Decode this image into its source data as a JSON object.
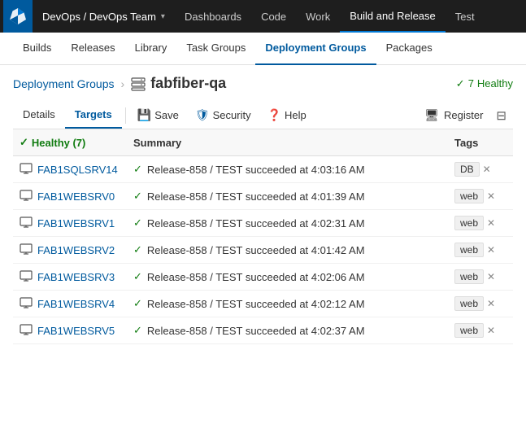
{
  "topNav": {
    "logo_alt": "Azure DevOps",
    "items": [
      {
        "id": "org",
        "label": "DevOps / DevOps Team",
        "hasChevron": true
      },
      {
        "id": "dashboards",
        "label": "Dashboards"
      },
      {
        "id": "code",
        "label": "Code"
      },
      {
        "id": "work",
        "label": "Work"
      },
      {
        "id": "buildrelease",
        "label": "Build and Release",
        "active": true
      },
      {
        "id": "test",
        "label": "Test"
      }
    ]
  },
  "secondNav": {
    "items": [
      {
        "id": "builds",
        "label": "Builds"
      },
      {
        "id": "releases",
        "label": "Releases"
      },
      {
        "id": "library",
        "label": "Library"
      },
      {
        "id": "taskgroups",
        "label": "Task Groups"
      },
      {
        "id": "deploymentgroups",
        "label": "Deployment Groups",
        "active": true
      },
      {
        "id": "packages",
        "label": "Packages"
      }
    ]
  },
  "breadcrumb": {
    "parent": "Deployment Groups",
    "separator": "›",
    "current": "fabfiber-qa",
    "healthyCount": "7",
    "healthyLabel": "Healthy"
  },
  "tabs": {
    "items": [
      {
        "id": "details",
        "label": "Details"
      },
      {
        "id": "targets",
        "label": "Targets",
        "active": true
      }
    ],
    "actions": [
      {
        "id": "save",
        "label": "Save",
        "icon": "save"
      },
      {
        "id": "security",
        "label": "Security",
        "icon": "shield"
      },
      {
        "id": "help",
        "label": "Help",
        "icon": "help"
      }
    ],
    "rightActions": [
      {
        "id": "register",
        "label": "Register",
        "icon": "register"
      },
      {
        "id": "filter",
        "label": "",
        "icon": "filter"
      }
    ]
  },
  "table": {
    "healthyHeader": "Healthy (7)",
    "columns": [
      "",
      "Summary",
      "Tags"
    ],
    "rows": [
      {
        "name": "FAB1SQLSRV14",
        "summary": "Release-858 / TEST succeeded at 4:03:16 AM",
        "tag": "DB"
      },
      {
        "name": "FAB1WEBSRV0",
        "summary": "Release-858 / TEST succeeded at 4:01:39 AM",
        "tag": "web"
      },
      {
        "name": "FAB1WEBSRV1",
        "summary": "Release-858 / TEST succeeded at 4:02:31 AM",
        "tag": "web"
      },
      {
        "name": "FAB1WEBSRV2",
        "summary": "Release-858 / TEST succeeded at 4:01:42 AM",
        "tag": "web"
      },
      {
        "name": "FAB1WEBSRV3",
        "summary": "Release-858 / TEST succeeded at 4:02:06 AM",
        "tag": "web"
      },
      {
        "name": "FAB1WEBSRV4",
        "summary": "Release-858 / TEST succeeded at 4:02:12 AM",
        "tag": "web"
      },
      {
        "name": "FAB1WEBSRV5",
        "summary": "Release-858 / TEST succeeded at 4:02:37 AM",
        "tag": "web"
      }
    ]
  },
  "colors": {
    "accent": "#005a9e",
    "green": "#107c10",
    "nav_bg": "#1e1e1e"
  }
}
